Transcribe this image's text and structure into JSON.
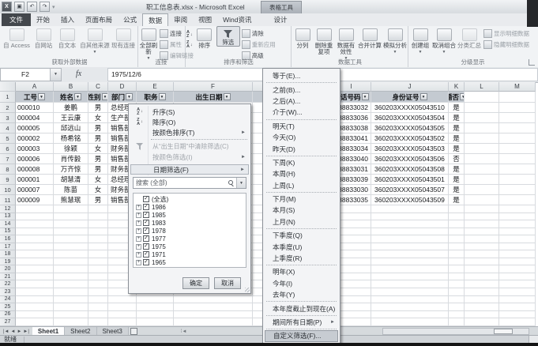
{
  "title_bar": {
    "title": "职工信息表.xlsx - Microsoft Excel",
    "contextual_group_label": "表格工具"
  },
  "ribbon_tabs": {
    "file": "文件",
    "tabs": [
      "开始",
      "插入",
      "页面布局",
      "公式",
      "数据",
      "审阅",
      "视图",
      "Wind资讯",
      "设计"
    ],
    "active": "数据"
  },
  "ribbon": {
    "get_external": {
      "label": "获取外部数据",
      "access": "自 Access",
      "web": "自网站",
      "text": "自文本",
      "other": "自其他来源",
      "existing": "现有连接"
    },
    "connections": {
      "label": "连接",
      "refresh_all": "全部刷新",
      "connections": "连接",
      "properties": "属性",
      "edit_links": "编辑链接"
    },
    "sort_filter": {
      "label": "排序和筛选",
      "sort": "排序",
      "filter": "筛选",
      "clear": "清除",
      "reapply": "重新应用",
      "advanced": "高级"
    },
    "data_tools": {
      "label": "数据工具",
      "text_to_columns": "分列",
      "remove_duplicates": "删除重复项",
      "validation": "数据有效性",
      "consolidate": "合并计算",
      "what_if": "模拟分析"
    },
    "outline": {
      "label": "分级显示",
      "group": "创建组",
      "ungroup": "取消组合",
      "subtotal": "分类汇总",
      "show_detail": "显示明细数据",
      "hide_detail": "隐藏明细数据"
    }
  },
  "formula_bar": {
    "name_box": "F2",
    "fx": "fx",
    "value": "1975/12/6"
  },
  "sheet": {
    "columns": [
      {
        "letter": "A",
        "header": "工号",
        "filter": true
      },
      {
        "letter": "B",
        "header": "姓名",
        "filter": true
      },
      {
        "letter": "C",
        "header": "性别",
        "filter": true
      },
      {
        "letter": "D",
        "header": "部门",
        "filter": true
      },
      {
        "letter": "E",
        "header": "职务",
        "filter": true
      },
      {
        "letter": "F",
        "header": "出生日期",
        "filter": true
      },
      {
        "letter": "",
        "header": "",
        "filter": true
      },
      {
        "letter": "",
        "header": "",
        "filter": true
      },
      {
        "letter": "I",
        "header": "电话号码",
        "filter": true
      },
      {
        "letter": "J",
        "header": "身份证号",
        "filter": true
      },
      {
        "letter": "K",
        "header": "婚否",
        "filter": true
      },
      {
        "letter": "L",
        "header": "",
        "filter": false
      },
      {
        "letter": "M",
        "header": "",
        "filter": false
      }
    ],
    "header_row_number": "1",
    "rows": [
      {
        "n": "2",
        "a": "000010",
        "b": "姜鹏",
        "c": "男",
        "d": "总经理办公室",
        "i": "88833032",
        "j": "360203XXXX05043510",
        "k": "是"
      },
      {
        "n": "3",
        "a": "000004",
        "b": "王云康",
        "c": "女",
        "d": "生产部",
        "i": "88833036",
        "j": "360203XXXX05043504",
        "k": "是"
      },
      {
        "n": "4",
        "a": "000005",
        "b": "邱远山",
        "c": "男",
        "d": "销售部",
        "i": "88833038",
        "j": "360203XXXX05043505",
        "k": "是"
      },
      {
        "n": "5",
        "a": "000002",
        "b": "杨希铭",
        "c": "男",
        "d": "销售部",
        "i": "88833041",
        "j": "360203XXXX05043502",
        "k": "是"
      },
      {
        "n": "6",
        "a": "000003",
        "b": "徐颖",
        "c": "女",
        "d": "财务部",
        "i": "88833034",
        "j": "360203XXXX05043503",
        "k": "是"
      },
      {
        "n": "7",
        "a": "000006",
        "b": "肖传毅",
        "c": "男",
        "d": "销售部",
        "i": "88833040",
        "j": "360203XXXX05043506",
        "k": "否"
      },
      {
        "n": "8",
        "a": "000008",
        "b": "万齐惊",
        "c": "男",
        "d": "财务部",
        "i": "88833031",
        "j": "360203XXXX05043508",
        "k": "是"
      },
      {
        "n": "9",
        "a": "000001",
        "b": "胡慧清",
        "c": "女",
        "d": "总经理办公室",
        "i": "88833039",
        "j": "360203XXXX05043501",
        "k": "是"
      },
      {
        "n": "10",
        "a": "000007",
        "b": "陈苗",
        "c": "女",
        "d": "财务部",
        "i": "88833030",
        "j": "360203XXXX05043507",
        "k": "是"
      },
      {
        "n": "11",
        "a": "000009",
        "b": "熊慧珉",
        "c": "男",
        "d": "销售部",
        "i": "88833035",
        "j": "360203XXXX05043509",
        "k": "是"
      }
    ],
    "empty_rows": {
      "from": 12,
      "to": 27
    }
  },
  "filter_menu": {
    "sort_asc": "升序(S)",
    "sort_desc": "降序(O)",
    "sort_by_color": "按颜色排序(T)",
    "clear_filter": "从“出生日期”中清除筛选(C)",
    "filter_by_color": "按颜色筛选(I)",
    "date_filters": "日期筛选(F)",
    "search_text": "搜索 (全部)",
    "tree": [
      "(全选)",
      "1986",
      "1985",
      "1983",
      "1978",
      "1977",
      "1975",
      "1971",
      "1965"
    ],
    "ok": "确定",
    "cancel": "取消"
  },
  "date_submenu": {
    "items": [
      {
        "label": "等于(E)...",
        "sep": true
      },
      {
        "label": "之前(B)..."
      },
      {
        "label": "之后(A)..."
      },
      {
        "label": "介于(W)...",
        "sep": true
      },
      {
        "label": "明天(T)"
      },
      {
        "label": "今天(O)"
      },
      {
        "label": "昨天(D)",
        "sep": true
      },
      {
        "label": "下周(K)"
      },
      {
        "label": "本周(H)"
      },
      {
        "label": "上周(L)",
        "sep": true
      },
      {
        "label": "下月(M)"
      },
      {
        "label": "本月(S)"
      },
      {
        "label": "上月(N)",
        "sep": true
      },
      {
        "label": "下季度(Q)"
      },
      {
        "label": "本季度(U)"
      },
      {
        "label": "上季度(R)",
        "sep": true
      },
      {
        "label": "明年(X)"
      },
      {
        "label": "今年(I)"
      },
      {
        "label": "去年(Y)",
        "sep": true
      },
      {
        "label": "本年度截止到现在(A)",
        "sep": true
      },
      {
        "label": "期间所有日期(P)",
        "arrow": true,
        "sep": true
      },
      {
        "label": "自定义筛选(F)...",
        "highlight": true
      }
    ]
  },
  "sheet_tabs": {
    "tabs": [
      "Sheet1",
      "Sheet2",
      "Sheet3"
    ],
    "active": "Sheet1"
  },
  "status_bar": {
    "text": "就绪"
  }
}
